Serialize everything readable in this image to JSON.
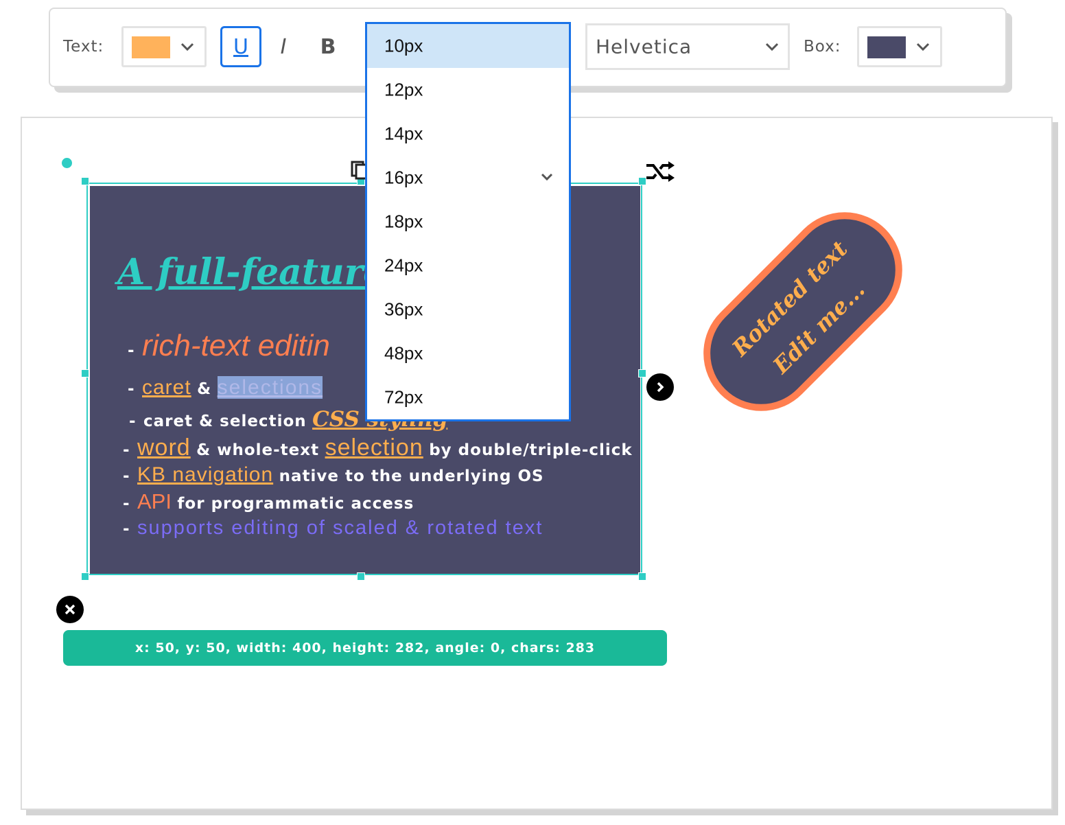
{
  "toolbar": {
    "text_label": "Text:",
    "text_color": "#ffb25b",
    "underline_label": "U",
    "italic_label": "I",
    "bold_label": "B",
    "font_family_value": "Helvetica",
    "box_label": "Box:",
    "box_color": "#4a4a68"
  },
  "font_size_dropdown": {
    "selected": "10px",
    "options": [
      "10px",
      "12px",
      "14px",
      "16px",
      "18px",
      "24px",
      "36px",
      "48px",
      "72px"
    ]
  },
  "textbox": {
    "heading": "A full-featured t",
    "line1_dash": "-",
    "line1_text": "rich-text editin",
    "line2_dash": "-",
    "line2_caret": "caret",
    "line2_amp": "&",
    "line2_selections": "selections",
    "line3_dash": "-",
    "line3_text": "caret & selection",
    "line3_styled": "CSS styling",
    "line4_dash": "-",
    "line4_word": "word",
    "line4_mid": "& whole-text",
    "line4_selection": "selection",
    "line4_tail": "by double/triple-click",
    "line5_dash": "-",
    "line5_kb": "KB navigation",
    "line5_tail": "native to the underlying OS",
    "line6_dash": "-",
    "line6_api": "API",
    "line6_tail": "for programmatic access",
    "line7_dash": "-",
    "line7_text": "supports editing of scaled & rotated text"
  },
  "status_bar": {
    "text": "x: 50, y: 50, width: 400, height: 282, angle: 0, chars: 283"
  },
  "rotated_box": {
    "line1": "Rotated text",
    "line2": "Edit me..."
  },
  "colors": {
    "accent_teal": "#2ecdc4",
    "status_green": "#1ab998",
    "box_bg": "#4a4a68",
    "orange": "#ff7f50",
    "light_orange": "#ffae4d",
    "purple": "#7b6cf6",
    "dropdown_border": "#1a73e8"
  },
  "icons": [
    "chevron-down-icon",
    "shuffle-icon",
    "chevron-right-icon",
    "close-icon",
    "duplicate-icon"
  ]
}
